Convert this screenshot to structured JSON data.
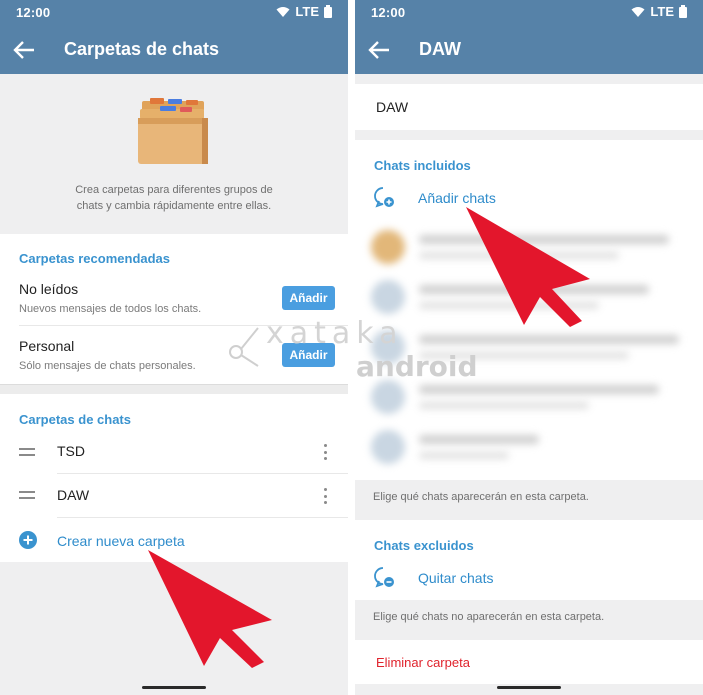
{
  "left": {
    "status": {
      "time": "12:00",
      "network": "LTE"
    },
    "appbar": {
      "title": "Carpetas de chats"
    },
    "intro": {
      "text_line1": "Crea carpetas para diferentes grupos de",
      "text_line2": "chats y cambia rápidamente entre ellas."
    },
    "recommended": {
      "header": "Carpetas recomendadas",
      "items": [
        {
          "title": "No leídos",
          "subtitle": "Nuevos mensajes de todos los chats.",
          "button": "Añadir"
        },
        {
          "title": "Personal",
          "subtitle": "Sólo mensajes de chats personales.",
          "button": "Añadir"
        }
      ]
    },
    "folders": {
      "header": "Carpetas de chats",
      "items": [
        {
          "name": "TSD"
        },
        {
          "name": "DAW"
        }
      ],
      "create_label": "Crear nueva carpeta"
    }
  },
  "right": {
    "status": {
      "time": "12:00",
      "network": "LTE"
    },
    "appbar": {
      "title": "DAW"
    },
    "name_field": {
      "value": "DAW"
    },
    "included": {
      "header": "Chats incluidos",
      "add_label": "Añadir chats",
      "hint": "Elige qué chats aparecerán en esta carpeta."
    },
    "excluded": {
      "header": "Chats excluidos",
      "remove_label": "Quitar chats",
      "hint": "Elige qué chats no aparecerán en esta carpeta."
    },
    "delete_label": "Eliminar carpeta"
  },
  "watermark": {
    "line1": "xataka",
    "line2": "android"
  },
  "colors": {
    "appbar": "#5682a8",
    "accent": "#3a93cf",
    "button": "#4a9ee0",
    "danger": "#e0232d",
    "arrow": "#e3162c"
  }
}
